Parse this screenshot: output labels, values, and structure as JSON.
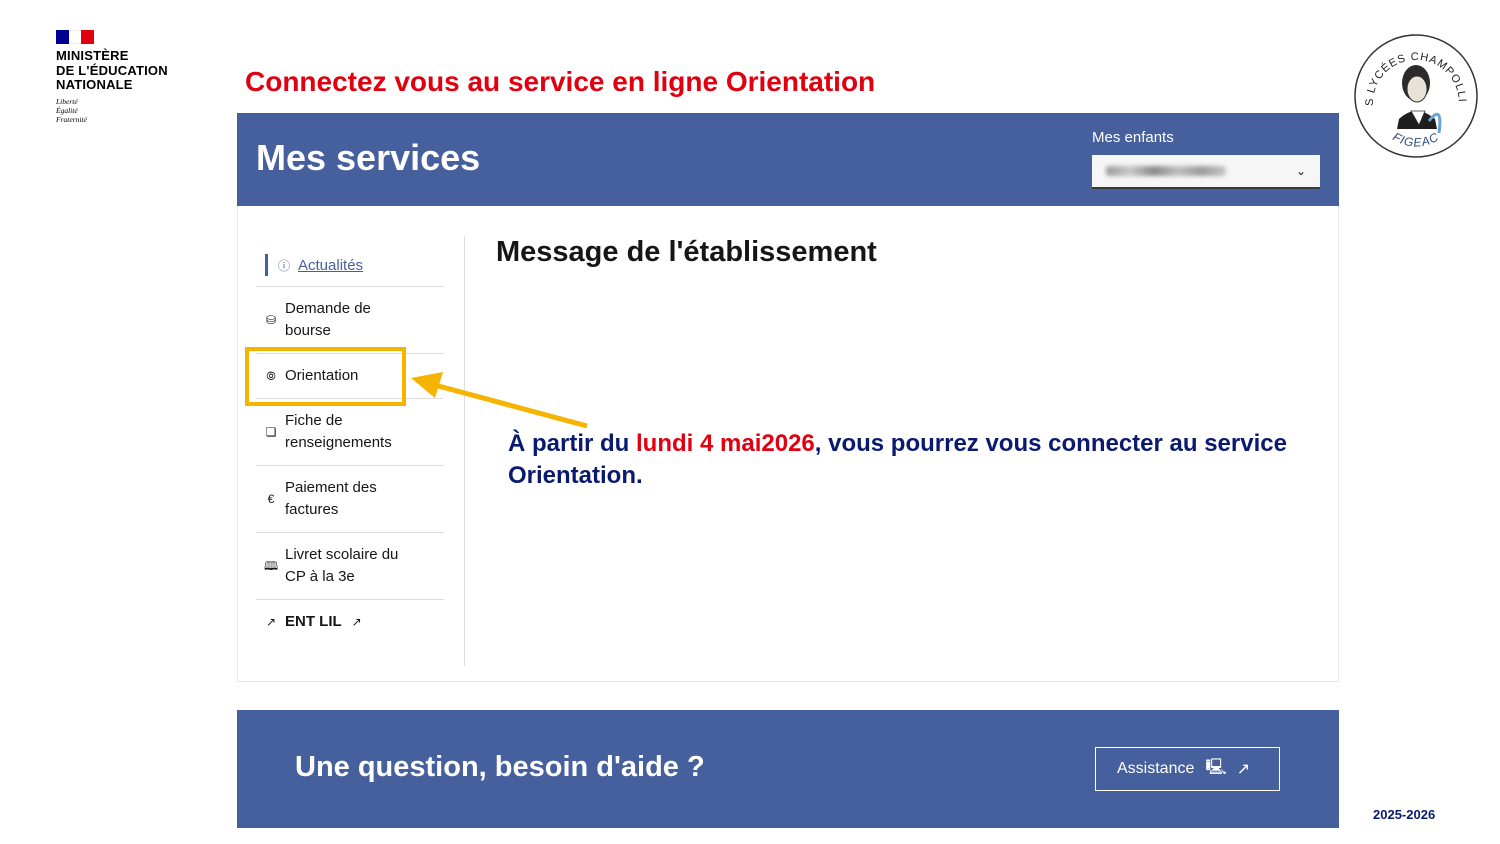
{
  "ministry": {
    "name_lines": [
      "MINISTÈRE",
      "DE L'ÉDUCATION",
      "NATIONALE"
    ],
    "motto_lines": [
      "Liberté",
      "Égalité",
      "Fraternité"
    ],
    "colors": {
      "blue": "#000091",
      "white": "#ffffff",
      "red": "#e1000f"
    }
  },
  "slide_title": "Connectez vous au service en ligne Orientation",
  "seal": {
    "top_text": "LES LYCÉES CHAMPOLLION",
    "bottom_text": "FIGEAC"
  },
  "header": {
    "title": "Mes services",
    "children_label": "Mes enfants",
    "select_icon": "chevron-down-icon"
  },
  "sidebar": {
    "items": [
      {
        "label": "Actualités",
        "icon": "info-icon",
        "active": true
      },
      {
        "label_lines": [
          "Demande de",
          "bourse"
        ],
        "icon": "hand-coins-icon"
      },
      {
        "label": "Orientation",
        "icon": "compass-icon"
      },
      {
        "label_lines": [
          "Fiche de",
          "renseignements"
        ],
        "icon": "edit-icon"
      },
      {
        "label_lines": [
          "Paiement des",
          "factures"
        ],
        "icon": "euro-icon"
      },
      {
        "label_lines": [
          "Livret scolaire du",
          "CP à la 3e"
        ],
        "icon": "book-icon"
      },
      {
        "label": "ENT LIL",
        "icon": "external-link-icon"
      }
    ]
  },
  "main": {
    "title": "Message de l'établissement"
  },
  "notice": {
    "part1": "À partir du ",
    "highlight": "lundi 4 mai2026",
    "part2": ", vous pourrez vous connecter au service Orientation."
  },
  "footer": {
    "help_text": "Une question, besoin d'aide ?",
    "assistance_label": "Assistance"
  },
  "year": "2025-2026",
  "colors": {
    "accent": "#465f9d",
    "title_red": "#e1000f",
    "notice_blue": "#0a1a6e",
    "highlight_yellow": "#f5b400"
  }
}
